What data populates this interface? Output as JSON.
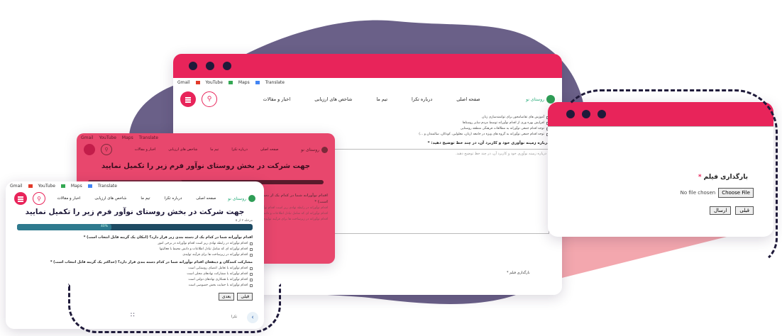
{
  "colors": {
    "primary": "#e8245a",
    "dark": "#1f1a3a",
    "blob": "#6a6088",
    "teal": "#1e4b63"
  },
  "bookmarks": [
    {
      "label": "Gmail",
      "icon": "gmail-icon"
    },
    {
      "label": "YouTube",
      "icon": "youtube-icon"
    },
    {
      "label": "Maps",
      "icon": "maps-icon"
    },
    {
      "label": "Translate",
      "icon": "translate-icon"
    }
  ],
  "site": {
    "logo": "روستای نو",
    "menu": [
      "صفحه اصلی",
      "درباره تکرا",
      "تیم ما",
      "شاخص های ارزیابی",
      "اخبار و مقالات"
    ]
  },
  "form": {
    "title": "جهت شرکت در بخش روستای نوآور فرم زیر را تکمیل نمایید",
    "step": "مرحله ۲ از ۵",
    "progress_label": "40%",
    "progress": 0.4,
    "q1": "اقدام نوآورانه شما در کدام یک از دسته بندی زیر قرار دارد؟ (امکان یک گزینه قابل انتخاب است) *",
    "q1_options": [
      "اقدام نوآورانه در رابطه نهادی ریز است اقدام نوآورانه در برخی امور",
      "اقدام نوآورانه ای که شامل تبادل اطلاعات و دانش محیط با فعالیتها",
      "اقدام نوآورانه در زیرساخت ها برای فرآیند تولیدی"
    ],
    "q2": "مشارکت کنندگان و ذینفعان اقدام نوآورانه شما در کدام دسته بندی قرار دارد؟ (حداکثر یک گزینه قابل انتخاب است) *",
    "q2_options": [
      "اقدام نوآورانه با تعامل اعضای روستایی است",
      "اقدام نوآورانه با مشارکت نهادهای محلی است",
      "اقدام نوآورانه با همکاری نهادهای دولتی است",
      "اقدام نوآورانه با حمایت بخش خصوصی است"
    ],
    "next": "بعدی",
    "prev": "قبلی",
    "submit": "ارسال",
    "brand_footer": "تکرا"
  },
  "big": {
    "checks": [
      "آموزش های تقاضامحور برای توانمندسازی زنان",
      "افزایش بهره وری از اقدام نوآورانه توسط مردم سایر روستاها",
      "توجه اقدام جمعی نوآورانه به مطالعات فرهنگی منطقه روستایی",
      "توجه اقدام جمعی نوآورانه به گروه های ویژه در جامعه (زنان، معلولین، کودکان، سالمندان و ...)"
    ],
    "q": "درباره زمینه نوآوری خود و کاربرد آن، در چند خط توضیح دهید: *",
    "placeholder": "درباره زمینه نوآوری خود و کاربرد آن، در چند خط توضیح دهید.",
    "upload_label": "بارگذاری فیلم *",
    "no_file": "No file chosen",
    "choose_file": "Choose File"
  },
  "zoom": {
    "upload_label": "بارگذاری فیلم",
    "required_mark": "*",
    "no_file": "No file chosen",
    "choose_file": "Choose File",
    "prev": "قبلی",
    "submit": "ارسال"
  }
}
